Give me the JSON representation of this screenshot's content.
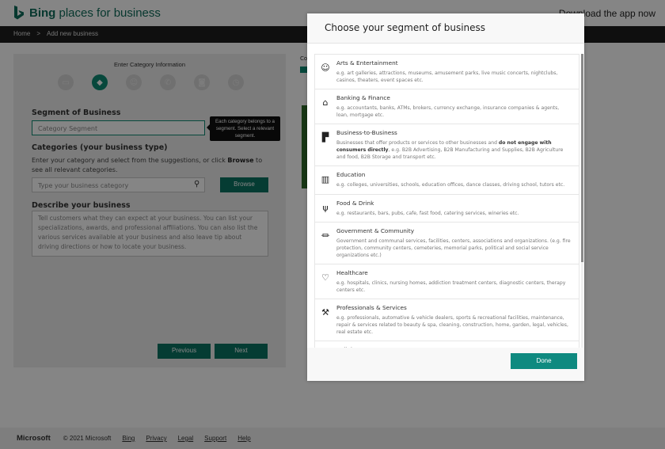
{
  "header": {
    "brand_bold": "Bing",
    "brand_rest": " places for business",
    "download_link": "Download the app now"
  },
  "breadcrumb": {
    "home": "Home",
    "separator": ">",
    "current": "Add new business"
  },
  "wizard": {
    "step_title": "Enter Category Information",
    "steps": [
      {
        "icon": "id-card-icon",
        "glyph": "▭",
        "active": false
      },
      {
        "icon": "tag-icon",
        "glyph": "◆",
        "active": true
      },
      {
        "icon": "user-edit-icon",
        "glyph": "☺",
        "active": false
      },
      {
        "icon": "phone-icon",
        "glyph": "✆",
        "active": false
      },
      {
        "icon": "camera-icon",
        "glyph": "◙",
        "active": false
      },
      {
        "icon": "clock-icon",
        "glyph": "◷",
        "active": false
      }
    ],
    "segment_label": "Segment of Business",
    "segment_placeholder": "Category Segment",
    "tooltip": "Each category belongs to a segment. Select a relevant segment.",
    "categories_label": "Categories (your business type)",
    "categories_help_pre": "Enter your category and select from the suggestions, or click ",
    "categories_help_bold": "Browse",
    "categories_help_post": " to see all relevant categories.",
    "category_placeholder": "Type your business category",
    "browse_button": "Browse",
    "describe_label": "Describe your business",
    "describe_placeholder": "Tell customers what they can expect at your business. You can list your specializations, awards, and professional affiliations. You can also list the various services available at your business and also leave tip about driving directions or how to locate your business.",
    "previous_button": "Previous",
    "next_button": "Next"
  },
  "side": {
    "label": "Co"
  },
  "modal": {
    "title": "Choose your segment of business",
    "done_button": "Done",
    "scroll_position": 0,
    "segments": [
      {
        "title": "Arts & Entertainment",
        "icon": "theater-masks-icon",
        "glyph": "☺",
        "desc": "e.g. art galleries, attractions, museums, amusement parks, live music concerts, nightclubs, casinos, theaters, event spaces etc."
      },
      {
        "title": "Banking & Finance",
        "icon": "bank-house-icon",
        "glyph": "⌂",
        "desc": "e.g. accountants, banks, ATMs, brokers, currency exchange, insurance companies & agents, loan, mortgage etc."
      },
      {
        "title": "Business-to-Business",
        "icon": "building-blocks-icon",
        "glyph": "▛",
        "desc_pre": "Businesses that offer products or services to other businesses and ",
        "desc_bold": "do not engage with consumers directly",
        "desc_post": ", e.g. B2B Advertising, B2B Manufacturing and Supplies, B2B Agriculture and food, B2B Storage and transport etc."
      },
      {
        "title": "Education",
        "icon": "book-icon",
        "glyph": "▥",
        "desc": "e.g. colleges, universities, schools, education offices, dance classes, driving school, tutors etc."
      },
      {
        "title": "Food & Drink",
        "icon": "fork-knife-icon",
        "glyph": "ψ",
        "desc": "e.g. restaurants, bars, pubs, cafe, fast food, catering services, wineries etc."
      },
      {
        "title": "Government & Community",
        "icon": "government-building-icon",
        "glyph": "⏛",
        "desc": "Government and communal services, facilities, centers, associations and organizations. (e.g. fire protection, community centers, cemeteries, memorial parks, political and social service organizations etc.)"
      },
      {
        "title": "Healthcare",
        "icon": "heart-pulse-icon",
        "glyph": "♡",
        "desc": "e.g. hospitals, clinics, nursing homes, addiction treatment centers, diagnostic centers, therapy centers etc."
      },
      {
        "title": "Professionals & Services",
        "icon": "tools-icon",
        "glyph": "⚒",
        "desc": "e.g. professionals, automative & vehicle dealers, sports & recreational facilities, maintenance, repair & services related to beauty & spa, cleaning, construction, home, garden, legal, vehicles, real estate etc."
      },
      {
        "title": "Religion",
        "icon": "religion-icon",
        "glyph": "✦",
        "desc": ""
      }
    ]
  },
  "footer": {
    "brand": "Microsoft",
    "copyright": "© 2021 Microsoft",
    "links": [
      "Bing",
      "Privacy",
      "Legal",
      "Support",
      "Help"
    ]
  },
  "colors": {
    "brand": "#0f6b5a",
    "accent": "#0f8a73",
    "done_button": "#0f8a80"
  }
}
